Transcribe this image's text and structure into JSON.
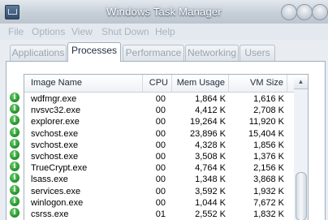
{
  "window": {
    "title": "Windows Task Manager",
    "controls": [
      "minimize",
      "maximize",
      "close"
    ]
  },
  "menu": [
    "File",
    "Options",
    "View",
    "Shut Down",
    "Help"
  ],
  "tabs": [
    "Applications",
    "Processes",
    "Performance",
    "Networking",
    "Users"
  ],
  "active_tab": "Processes",
  "columns": [
    "Image Name",
    "CPU",
    "Mem Usage",
    "VM Size"
  ],
  "processes": [
    {
      "name": "wdfmgr.exe",
      "cpu": "00",
      "mem": "1,864 K",
      "vm": "1,616 K"
    },
    {
      "name": "nvsvc32.exe",
      "cpu": "00",
      "mem": "4,412 K",
      "vm": "2,708 K"
    },
    {
      "name": "explorer.exe",
      "cpu": "00",
      "mem": "19,264 K",
      "vm": "11,920 K"
    },
    {
      "name": "svchost.exe",
      "cpu": "00",
      "mem": "23,896 K",
      "vm": "15,404 K"
    },
    {
      "name": "svchost.exe",
      "cpu": "00",
      "mem": "4,328 K",
      "vm": "1,856 K"
    },
    {
      "name": "svchost.exe",
      "cpu": "00",
      "mem": "3,508 K",
      "vm": "1,376 K"
    },
    {
      "name": "TrueCrypt.exe",
      "cpu": "00",
      "mem": "4,764 K",
      "vm": "2,156 K"
    },
    {
      "name": "lsass.exe",
      "cpu": "00",
      "mem": "1,348 K",
      "vm": "3,868 K"
    },
    {
      "name": "services.exe",
      "cpu": "00",
      "mem": "3,592 K",
      "vm": "1,932 K"
    },
    {
      "name": "winlogon.exe",
      "cpu": "00",
      "mem": "1,044 K",
      "vm": "7,672 K"
    },
    {
      "name": "csrss.exe",
      "cpu": "01",
      "mem": "2,552 K",
      "vm": "1,832 K"
    }
  ],
  "icon": "green-check-icon",
  "accent": "#1f8e2a"
}
